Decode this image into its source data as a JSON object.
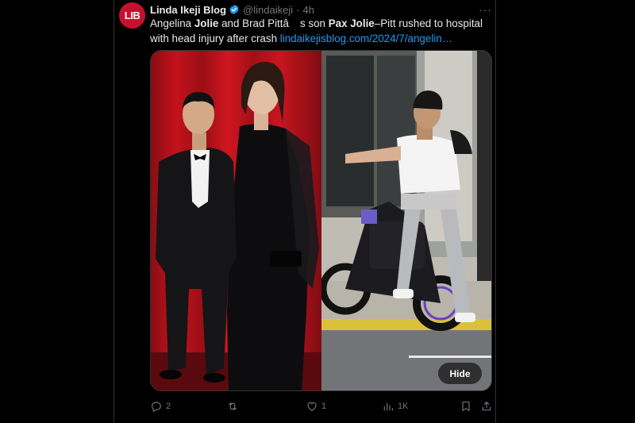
{
  "post": {
    "avatar_text": "LIB",
    "author_name": "Linda Ikeji Blog",
    "handle": "@lindaikeji",
    "separator": "·",
    "time": "4h",
    "more_label": "···",
    "text_part1": "Angelina ",
    "text_bold1": "Jolie",
    "text_part2": " and Brad Pittâ",
    "text_part3": "s son ",
    "text_bold2": "Pax Jolie",
    "text_part4": "–Pitt rushed to hospital with head injury after crash ",
    "link": "lindaikejisblog.com/2024/7/angelin…"
  },
  "media": {
    "hide_label": "Hide"
  },
  "actions": {
    "replies": "2",
    "reposts": "",
    "likes": "1",
    "views": "1K"
  },
  "colors": {
    "background": "#000000",
    "text": "#e7e9ea",
    "muted": "#71767b",
    "link": "#1d9bf0",
    "verified": "#1d9bf0",
    "avatar": "#c8102e"
  }
}
